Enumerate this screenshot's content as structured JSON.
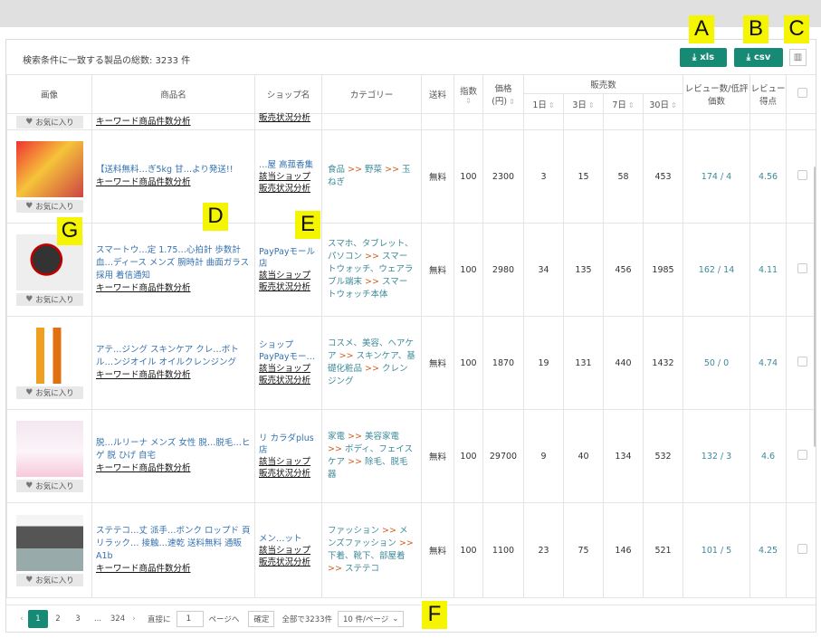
{
  "summary": "検索条件に一致する製品の総数: 3233 件",
  "buttons": {
    "xls": "xls",
    "csv": "csv"
  },
  "markers": [
    "A",
    "B",
    "C",
    "D",
    "E",
    "F",
    "G"
  ],
  "headers": {
    "image": "画像",
    "name": "商品名",
    "shop": "ショップ名",
    "category": "カテゴリー",
    "shipping": "送料",
    "index": "指数",
    "price": "価格\n(円)",
    "sales": "販売数",
    "d1": "1日",
    "d3": "3日",
    "d7": "7日",
    "d30": "30日",
    "reviews": "レビュー数/低評価数",
    "score": "レビュー得点"
  },
  "partial_row": {
    "fav": "お気に入り",
    "keyword_link": "キーワード商品件数分析",
    "shop_link": "販売状況分析"
  },
  "rows": [
    {
      "name_text": "【送料無料…ぎ5kg 甘…より発送!!",
      "shop_text": "…屋 高菰香集",
      "category": [
        "食品",
        "野菜",
        "玉ねぎ"
      ],
      "shipping": "無料",
      "index": "100",
      "price": "2300",
      "d1": "3",
      "d3": "15",
      "d7": "58",
      "d30": "453",
      "reviews": "174 / 4",
      "score": "4.56"
    },
    {
      "name_text": "スマートウ…定 1.75…心拍計 歩数計 血…ディース メンズ 腕時計 曲面ガラス採用 着信通知",
      "shop_text": "PayPayモール店",
      "category": [
        "スマホ、タブレット、パソコン",
        "スマートウォッチ、ウェアラブル端末",
        "スマートウォッチ本体"
      ],
      "shipping": "無料",
      "index": "100",
      "price": "2980",
      "d1": "34",
      "d3": "135",
      "d7": "456",
      "d30": "1985",
      "reviews": "162 / 14",
      "score": "4.11"
    },
    {
      "name_text": "アテ…ジング スキンケア クレ…ボトル…ンジオイル オイルクレンジング",
      "shop_text": "ショップ PayPayモー…",
      "category": [
        "コスメ、美容、ヘアケア",
        "スキンケア、基礎化粧品",
        "クレンジング"
      ],
      "shipping": "無料",
      "index": "100",
      "price": "1870",
      "d1": "19",
      "d3": "131",
      "d7": "440",
      "d30": "1432",
      "reviews": "50 / 0",
      "score": "4.74"
    },
    {
      "name_text": "脱…ルリーナ メンズ 女性 脱…脱毛…ヒゲ 脱 ひげ 自宅",
      "shop_text": "リ カラダplus店",
      "category": [
        "家電",
        "美容家電",
        "ボディ、フェイスケア",
        "除毛、脱毛器"
      ],
      "shipping": "無料",
      "index": "100",
      "price": "29700",
      "d1": "9",
      "d3": "40",
      "d7": "134",
      "d30": "532",
      "reviews": "132 / 3",
      "score": "4.6"
    },
    {
      "name_text": "ステテコ…丈 派手…ボンク ロップド 頁 リラック… 接触…速乾 送料無料 通販A1b",
      "shop_text": "メン…ット",
      "category": [
        "ファッション",
        "メンズファッション",
        "下着、靴下、部屋着",
        "ステテコ"
      ],
      "shipping": "無料",
      "index": "100",
      "price": "1100",
      "d1": "23",
      "d3": "75",
      "d7": "146",
      "d30": "521",
      "reviews": "101 / 5",
      "score": "4.25"
    }
  ],
  "row_common": {
    "fav": "お気に入り",
    "keyword_link": "キーワード商品件数分析",
    "shop_link1": "該当ショップ",
    "shop_link2": "販売状況分析"
  },
  "pager": {
    "pages": [
      "1",
      "2",
      "3",
      "...",
      "324"
    ],
    "goto_label": "直接に",
    "goto_value": "1",
    "page_suffix": "ページへ",
    "confirm": "確定",
    "total": "全部で3233件",
    "per_page": "10 件/ページ"
  },
  "colors": {
    "accent": "#168a74",
    "link": "#3572b0",
    "category": "#3d8a9a",
    "marker": "#f5f500"
  }
}
